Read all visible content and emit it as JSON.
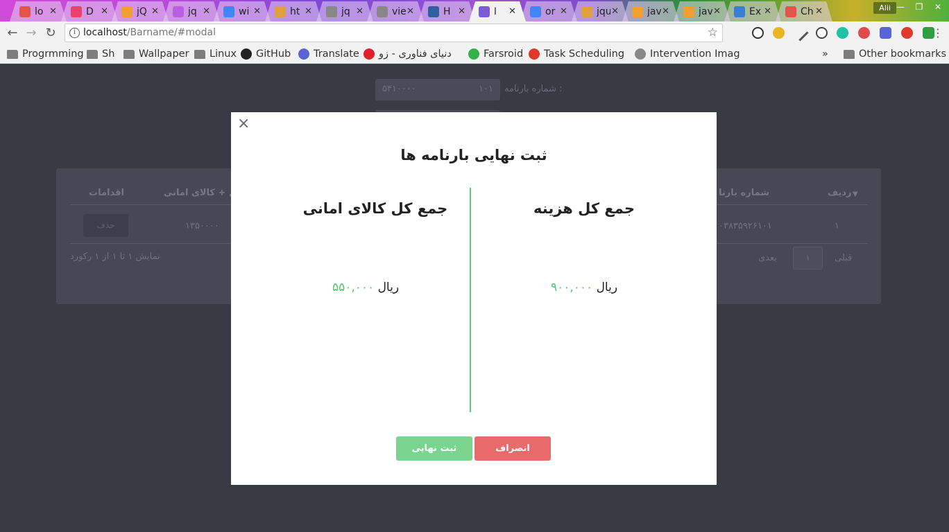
{
  "browser": {
    "tabs": [
      {
        "label": "lo",
        "color": "#e2554d"
      },
      {
        "label": "D",
        "color": "#e8436a"
      },
      {
        "label": "jQ",
        "color": "#f0a030"
      },
      {
        "label": "jq",
        "color": "#b860e0"
      },
      {
        "label": "wi",
        "color": "#4285f4"
      },
      {
        "label": "ht",
        "color": "#e0a040"
      },
      {
        "label": "jq",
        "color": "#888888"
      },
      {
        "label": "vie",
        "color": "#888888"
      },
      {
        "label": "H",
        "color": "#3060a0"
      },
      {
        "label": "ا",
        "color": "#7a5cd6"
      },
      {
        "label": "or",
        "color": "#4285f4"
      },
      {
        "label": "jqu",
        "color": "#e0a040"
      },
      {
        "label": "jav",
        "color": "#f0a030"
      },
      {
        "label": "jav",
        "color": "#f0a030"
      },
      {
        "label": "Ex",
        "color": "#3a7fd6"
      },
      {
        "label": "Ch",
        "color": "#e2554d"
      }
    ],
    "active_tab_index": 9,
    "user_name": "Alii",
    "url_host": "localhost",
    "url_path": "/Barname/#modal",
    "bookmarks": [
      {
        "label": "Progrmming",
        "icon": "folder-icon"
      },
      {
        "label": "Sh",
        "icon": "folder-icon"
      },
      {
        "label": "Wallpaper",
        "icon": "folder-icon"
      },
      {
        "label": "Linux",
        "icon": "folder-icon"
      },
      {
        "label": "GitHub",
        "icon": "github-icon"
      },
      {
        "label": "Translate",
        "icon": "translate-icon"
      },
      {
        "label": "دنیای فناوری - زو",
        "icon": "zoomit-icon"
      },
      {
        "label": "Farsroid",
        "icon": "farsroid-icon"
      },
      {
        "label": "Task Scheduling",
        "icon": "laravel-icon"
      },
      {
        "label": "Intervention Imag",
        "icon": "page-icon"
      }
    ],
    "overflow_label": "»",
    "other_bookmarks": "Other bookmarks"
  },
  "background_page": {
    "field_label": "شماره بارنامه :",
    "field_value_left": "۵۴۱۰۰۰۰",
    "field_value_right": "۱۰۱",
    "headers": {
      "row": "ردیف",
      "number": "شماره بارنا",
      "total": "کل + کالای امانی",
      "actions": "اقدامات"
    },
    "row_index": "۱",
    "row_number": "۰۳۸۳۵۹۲۶۱۰۱",
    "row_total": "۱۳۵۰۰۰۰",
    "delete_label": "حذف",
    "info_text": "نمایش ۱ تا ۱ از ۱ رکورد",
    "prev_label": "قبلی",
    "next_label": "بعدی",
    "page_number": "۱"
  },
  "modal": {
    "title": "ثبت نهایی بارنامه ها",
    "right_heading": "جمع کل هزینه",
    "right_amount": "۹۰۰,۰۰۰",
    "left_heading": "جمع کل کالای امانی",
    "left_amount": "۵۵۰,۰۰۰",
    "currency": "ریال",
    "submit_label": "ثبت نهایی",
    "cancel_label": "انصراف",
    "close_glyph": "×",
    "accent_color": "#5ccc79"
  }
}
